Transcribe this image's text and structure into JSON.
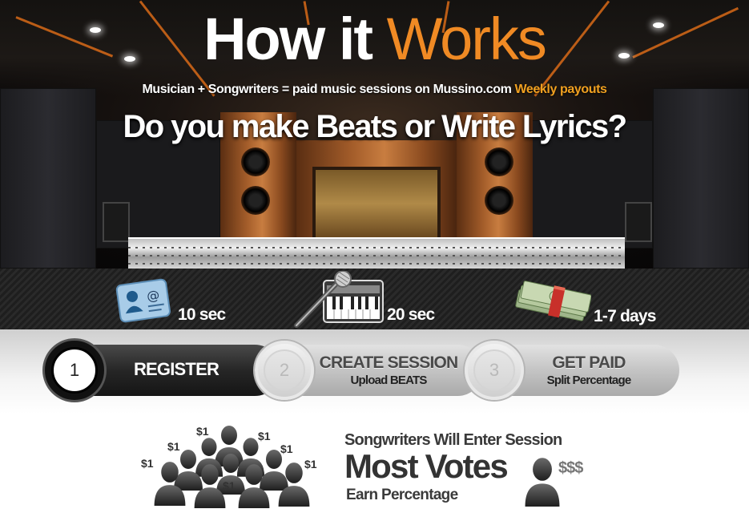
{
  "hero": {
    "title_main": "How it",
    "title_accent": "Works",
    "tagline_main": "Musician + Songwriters = paid music sessions on Mussino.com",
    "tagline_accent": "Weekly payouts",
    "headline": "Do you make Beats or Write Lyrics?"
  },
  "stats": [
    {
      "icon": "contact-card-icon",
      "label": "10 sec"
    },
    {
      "icon": "microphone-keyboard-icon",
      "label": "20 sec"
    },
    {
      "icon": "money-stack-icon",
      "label": "1-7 days"
    }
  ],
  "steps": [
    {
      "number": "1",
      "title": "REGISTER",
      "subtitle": ""
    },
    {
      "number": "2",
      "title": "CREATE SESSION",
      "subtitle": "Upload BEATS"
    },
    {
      "number": "3",
      "title": "GET PAID",
      "subtitle": "Split Percentage"
    }
  ],
  "bottom": {
    "dollar_label": "$1",
    "line1": "Songwriters Will Enter Session",
    "line2": "Most Votes",
    "line3": "Earn Percentage",
    "money": "$$$"
  },
  "colors": {
    "accent_orange": "#f08a24",
    "tagline_gold": "#f0a020"
  }
}
